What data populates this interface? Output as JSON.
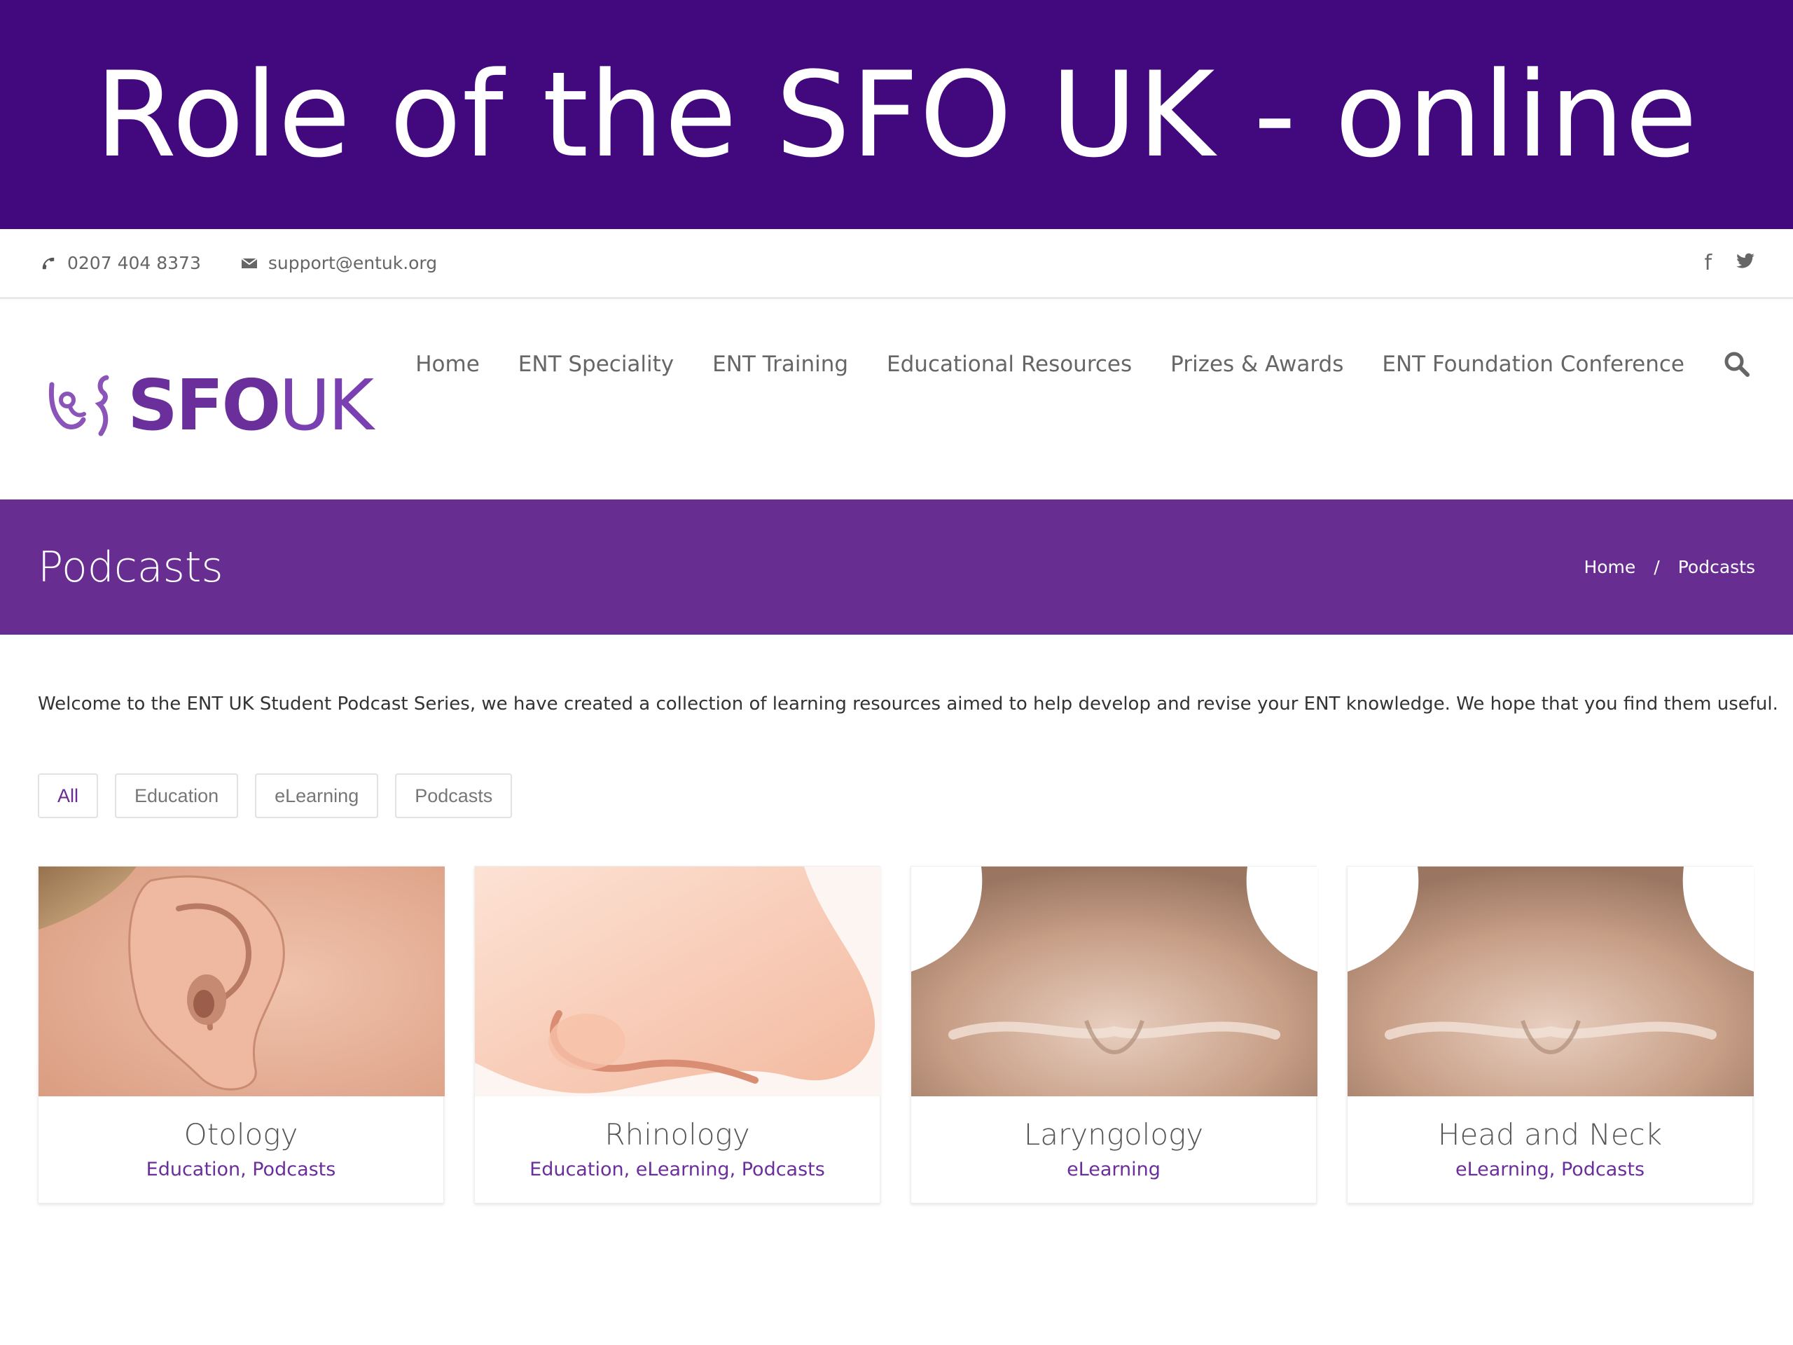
{
  "slide": {
    "title": "Role of the SFO UK - online"
  },
  "topbar": {
    "phone": "0207 404 8373",
    "email": "support@entuk.org",
    "icons": {
      "phone": "phone-icon",
      "email": "envelope-icon",
      "facebook": "facebook-icon",
      "twitter": "twitter-icon"
    }
  },
  "logo": {
    "sfo": "SFO",
    "uk": "UK"
  },
  "nav": {
    "items": [
      "Home",
      "ENT Speciality",
      "ENT Training",
      "Educational Resources",
      "Prizes & Awards",
      "ENT Foundation Conference"
    ],
    "search_icon": "search-icon"
  },
  "page": {
    "title": "Podcasts",
    "breadcrumb": [
      "Home",
      "/",
      "Podcasts"
    ]
  },
  "welcome": "Welcome to the ENT UK Student Podcast Series, we have created a collection of learning resources aimed to help develop and revise your ENT knowledge. We hope that you find them useful.",
  "filters": [
    {
      "label": "All",
      "active": true
    },
    {
      "label": "Education",
      "active": false
    },
    {
      "label": "eLearning",
      "active": false
    },
    {
      "label": "Podcasts",
      "active": false
    }
  ],
  "cards": [
    {
      "title": "Otology",
      "tags": "Education, Podcasts"
    },
    {
      "title": "Rhinology",
      "tags": "Education, eLearning, Podcasts"
    },
    {
      "title": "Laryngology",
      "tags": "eLearning"
    },
    {
      "title": "Head and Neck",
      "tags": "eLearning, Podcasts"
    }
  ],
  "colors": {
    "banner": "#42087e",
    "brand": "#672d91",
    "text": "#555555"
  }
}
